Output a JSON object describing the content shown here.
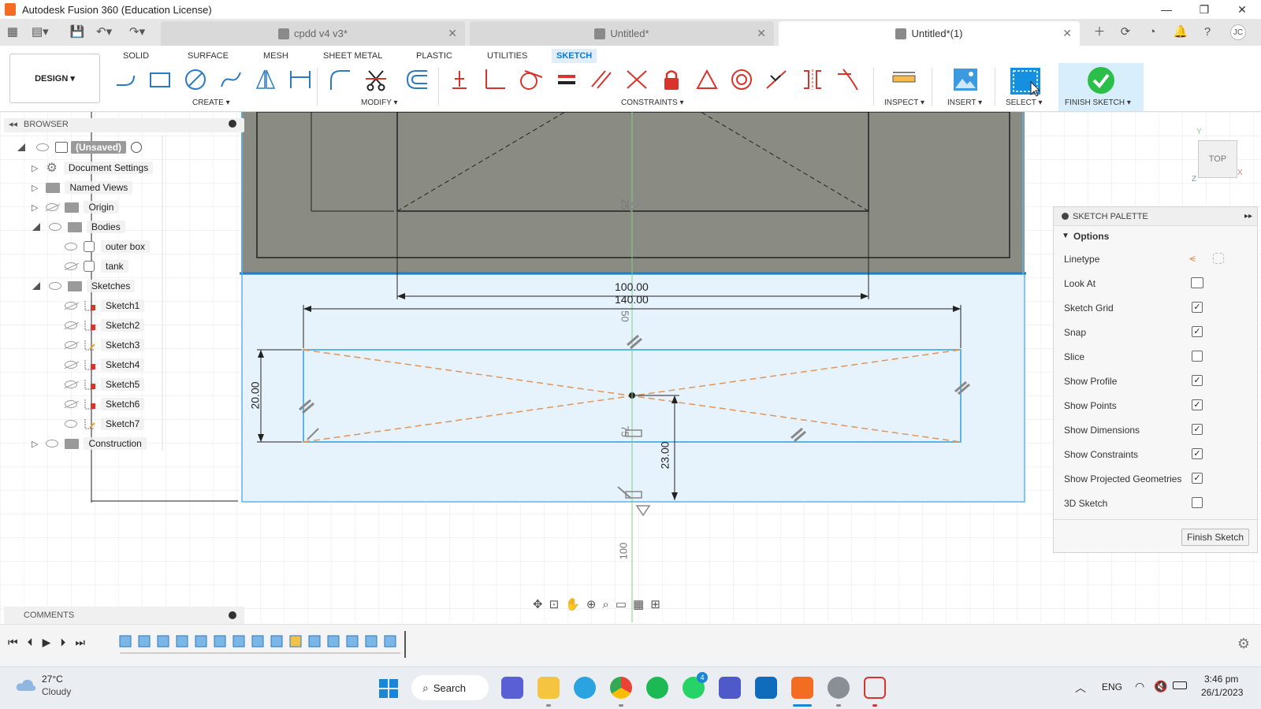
{
  "window": {
    "title": "Autodesk Fusion 360 (Education License)",
    "controls": [
      "—",
      "❐",
      "✕"
    ]
  },
  "doc_tabs": [
    {
      "label": "cpdd v4 v3*",
      "active": false
    },
    {
      "label": "Untitled*",
      "active": false
    },
    {
      "label": "Untitled*(1)",
      "active": true
    }
  ],
  "user_initials": "JC",
  "toolbar": {
    "design_label": "DESIGN ▾",
    "workspace_tabs": [
      "SOLID",
      "SURFACE",
      "MESH",
      "SHEET METAL",
      "PLASTIC",
      "UTILITIES",
      "SKETCH"
    ],
    "active_tab": "SKETCH",
    "groups": {
      "create": "CREATE ▾",
      "modify": "MODIFY ▾",
      "constraints": "CONSTRAINTS ▾",
      "inspect": "INSPECT ▾",
      "insert": "INSERT ▾",
      "select": "SELECT ▾",
      "finish": "FINISH SKETCH ▾"
    }
  },
  "browser": {
    "title": "BROWSER",
    "root": "(Unsaved)",
    "items": [
      {
        "label": "Document Settings",
        "icon": "gear-icon"
      },
      {
        "label": "Named Views",
        "icon": "folder-icon"
      },
      {
        "label": "Origin",
        "icon": "folder-icon"
      },
      {
        "label": "Bodies",
        "icon": "folder-icon"
      },
      {
        "label": "outer box",
        "icon": "body-icon"
      },
      {
        "label": "tank",
        "icon": "body-icon"
      },
      {
        "label": "Sketches",
        "icon": "folder-icon"
      },
      {
        "label": "Sketch1",
        "icon": "sketch-icon"
      },
      {
        "label": "Sketch2",
        "icon": "sketch-icon"
      },
      {
        "label": "Sketch3",
        "icon": "sketch-icon"
      },
      {
        "label": "Sketch4",
        "icon": "sketch-icon"
      },
      {
        "label": "Sketch5",
        "icon": "sketch-icon"
      },
      {
        "label": "Sketch6",
        "icon": "sketch-icon"
      },
      {
        "label": "Sketch7",
        "icon": "sketch-icon"
      },
      {
        "label": "Construction",
        "icon": "folder-icon"
      }
    ]
  },
  "sketch": {
    "dimensions": {
      "d100": "100.00",
      "d140": "140.00",
      "d20": "20.00",
      "d23": "23.00",
      "axis_25": "25",
      "axis_50": "50",
      "axis_75": "75",
      "axis_100": "100"
    }
  },
  "viewcube": {
    "face": "TOP",
    "x": "X",
    "y": "Y",
    "z": "Z"
  },
  "palette": {
    "title": "SKETCH PALETTE",
    "section": "Options",
    "rows": [
      {
        "label": "Linetype",
        "type": "icons"
      },
      {
        "label": "Look At",
        "type": "icon"
      },
      {
        "label": "Sketch Grid",
        "checked": true
      },
      {
        "label": "Snap",
        "checked": true
      },
      {
        "label": "Slice",
        "checked": false
      },
      {
        "label": "Show Profile",
        "checked": true
      },
      {
        "label": "Show Points",
        "checked": true
      },
      {
        "label": "Show Dimensions",
        "checked": true
      },
      {
        "label": "Show Constraints",
        "checked": true
      },
      {
        "label": "Show Projected Geometries",
        "checked": true
      },
      {
        "label": "3D Sketch",
        "checked": false
      }
    ],
    "finish_button": "Finish Sketch"
  },
  "comments": {
    "title": "COMMENTS"
  },
  "taskbar": {
    "weather_temp": "27°C",
    "weather_desc": "Cloudy",
    "search_label": "Search",
    "lang": "ENG",
    "time": "3:46 pm",
    "date": "26/1/2023",
    "whatsapp_badge": "4"
  },
  "colors": {
    "accent_blue": "#0a7cd6",
    "sketch_line": "#5bb6e8",
    "sketch_fill": "#e6f3fc",
    "body_gray": "#8a8c84",
    "construction_orange": "#e0955a",
    "finish_green": "#2bbf4a",
    "constraint_red": "#d9342b"
  }
}
